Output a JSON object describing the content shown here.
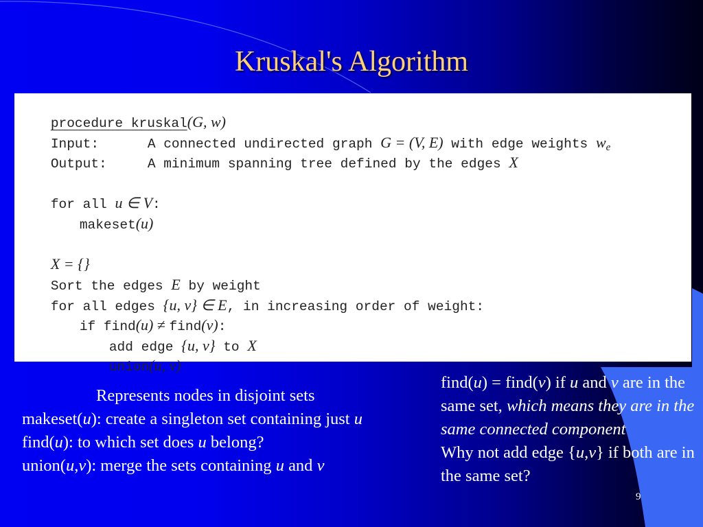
{
  "slide": {
    "title": "Kruskal's Algorithm",
    "page_number": "9",
    "colors": {
      "title": "#ffd07a",
      "background_left": "#0000f2",
      "background_right": "#000018",
      "accent_panel": "#3a68f5",
      "text": "#ffffff"
    }
  },
  "code": {
    "header_keyword": "procedure kruskal",
    "header_args": "(G, w)",
    "input_label": "Input:",
    "input_text_1": "A connected undirected graph ",
    "input_math": "G = (V, E)",
    "input_text_2": " with edge weights ",
    "input_weight": "w",
    "input_weight_sub": "e",
    "output_label": "Output:",
    "output_text": "A minimum spanning tree defined by the edges ",
    "output_math": "X",
    "for_all_1": "for all ",
    "for_all_1_math": "u ∈ V",
    "for_all_1_colon": ":",
    "makeset_fn": "makeset",
    "makeset_args": "(u)",
    "x_init": "X = {}",
    "sort_1": "Sort the edges ",
    "sort_math": "E",
    "sort_2": " by weight",
    "for_all_2": "for all edges ",
    "for_all_2_math": "{u, v} ∈ E",
    "for_all_2_rest": ", in increasing order of weight:",
    "if_kw": "if find",
    "if_arg_u": "(u)",
    "if_neq": " ≠ ",
    "if_find": "find",
    "if_arg_v": "(v)",
    "if_colon": ":",
    "add_edge": "add edge ",
    "add_edge_math": "{u, v}",
    "add_edge_to": " to ",
    "add_edge_x": "X",
    "union_fn": "union",
    "union_args": "(u, v)"
  },
  "left_notes": {
    "heading": "Represents nodes in disjoint sets",
    "lines": [
      {
        "pre": "makeset(",
        "var": "u",
        "mid": "): create a singleton set containing just ",
        "var2": "u",
        "post": ""
      },
      {
        "pre": "find(",
        "var": "u",
        "mid": "): to which set does ",
        "var2": "u",
        "post": " belong?"
      },
      {
        "pre": "union(",
        "var": "u",
        "mid": ",",
        "var2": "v",
        "post": "): merge the sets containing ",
        "var3": "u",
        "and": " and ",
        "var4": "v"
      }
    ]
  },
  "right_notes": {
    "p1_a": "find(",
    "p1_u": "u",
    "p1_b": ") = find(",
    "p1_v": "v",
    "p1_c": ") if ",
    "p1_u2": "u",
    "p1_d": " and ",
    "p1_v2": "v",
    "p1_e": " are in the same set, ",
    "p1_italic": "which means they are in the same connected component",
    "p2_a": "Why not add edge {",
    "p2_u": "u",
    "p2_comma": ",",
    "p2_v": "v",
    "p2_b": "} if both are in the same set?"
  }
}
